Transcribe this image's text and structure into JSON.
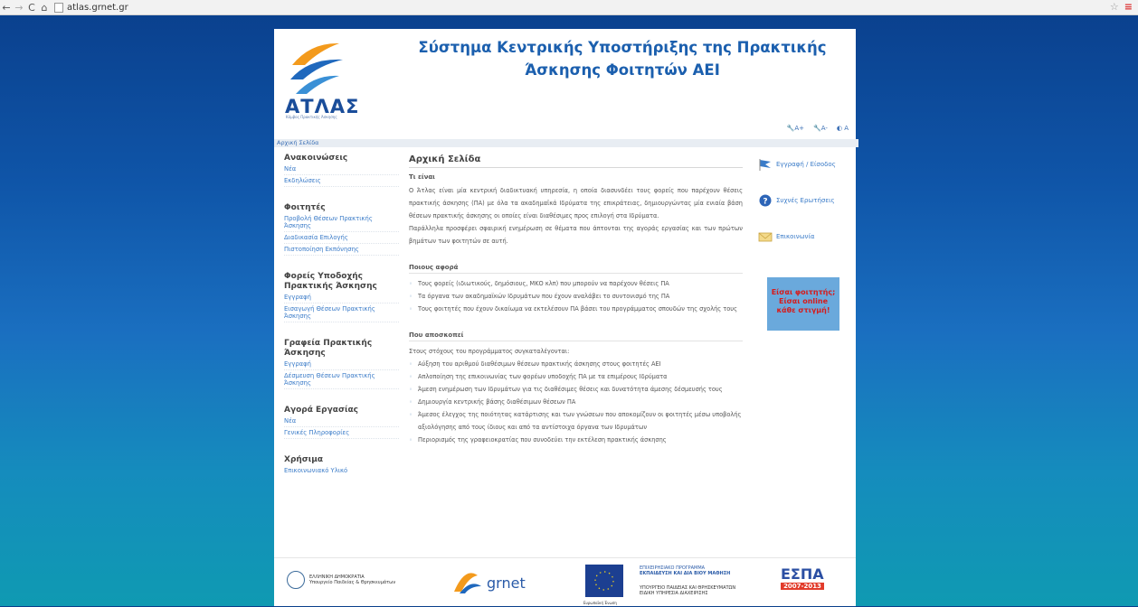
{
  "browser": {
    "url": "atlas.grnet.gr",
    "back": "←",
    "forward": "→",
    "reload": "C",
    "home": "⌂",
    "star": "☆",
    "menu": "≡"
  },
  "header": {
    "logo_text": "ΑΤΛΑΣ",
    "logo_subtitle": "Κόμβος Πρακτικής Άσκησης",
    "site_title": "Σύστημα Κεντρικής Υποστήριξης της Πρακτικής Άσκησης Φοιτητών ΑΕΙ",
    "accessibility": {
      "increase": "A+",
      "decrease": "A-",
      "contrast": "A"
    }
  },
  "breadcrumb": "Αρχική Σελίδα",
  "sidebar": {
    "sections": [
      {
        "title": "Ανακοινώσεις",
        "items": [
          "Νέα",
          "Εκδηλώσεις"
        ]
      },
      {
        "title": "Φοιτητές",
        "items": [
          "Προβολή Θέσεων Πρακτικής Άσκησης",
          "Διαδικασία Επιλογής",
          "Πιστοποίηση Εκπόνησης"
        ]
      },
      {
        "title": "Φορείς Υποδοχής Πρακτικής Άσκησης",
        "items": [
          "Εγγραφή",
          "Εισαγωγή Θέσεων Πρακτικής Άσκησης"
        ]
      },
      {
        "title": "Γραφεία Πρακτικής Άσκησης",
        "items": [
          "Εγγραφή",
          "Δέσμευση Θέσεων Πρακτικής Άσκησης"
        ]
      },
      {
        "title": "Αγορά Εργασίας",
        "items": [
          "Νέα",
          "Γενικές Πληροφορίες"
        ]
      },
      {
        "title": "Χρήσιμα",
        "items": [
          "Επικοινωνιακό Υλικό"
        ]
      }
    ]
  },
  "main": {
    "title": "Αρχική Σελίδα",
    "what_title": "Τι είναι",
    "what_p1": "Ο Άτλας είναι μία κεντρική διαδικτυακή υπηρεσία, η οποία διασυνδέει τους φορείς που παρέχουν θέσεις πρακτικής άσκησης (ΠΑ) με όλα τα ακαδημαϊκά Ιδρύματα της επικράτειας, δημιουργώντας μία ενιαία βάση θέσεων πρακτικής άσκησης οι οποίες είναι διαθέσιμες προς επιλογή στα Ιδρύματα.",
    "what_p2": "Παράλληλα προσφέρει σφαιρική ενημέρωση σε θέματα που άπτονται της αγοράς εργασίας και των πρώτων βημάτων των φοιτητών σε αυτή.",
    "who_title": "Ποιους αφορά",
    "who_items": [
      "Τους φορείς (ιδιωτικούς, δημόσιους, ΜΚΟ κλπ) που μπορούν να παρέχουν θέσεις ΠΑ",
      "Τα όργανα των ακαδημαϊκών Ιδρυμάτων που έχουν αναλάβει το συντονισμό της ΠΑ",
      "Τους φοιτητές που έχουν δικαίωμα να εκτελέσουν ΠΑ βάσει του προγράμματος σπουδών της σχολής τους"
    ],
    "goal_title": "Που αποσκοπεί",
    "goal_intro": "Στους στόχους του προγράμματος συγκαταλέγονται:",
    "goal_items": [
      "Αύξηση του αριθμού διαθέσιμων θέσεων πρακτικής άσκησης στους φοιτητές ΑΕΙ",
      "Απλοποίηση της επικοινωνίας των φορέων υποδοχής ΠΑ με τα επιμέρους Ιδρύματα",
      "Άμεση ενημέρωση των Ιδρυμάτων για τις διαθέσιμες θέσεις και δυνατότητα άμεσης δέσμευσής τους",
      "Δημιουργία κεντρικής βάσης διαθέσιμων θέσεων ΠΑ",
      "Άμεσος έλεγχος της ποιότητας κατάρτισης και των γνώσεων που αποκομίζουν οι φοιτητές μέσω υποβολής αξιολόγησης από τους ίδιους και από τα αντίστοιχα όργανα των Ιδρυμάτων",
      "Περιορισμός της γραφειοκρατίας που συνοδεύει την εκτέλεση πρακτικής άσκησης"
    ]
  },
  "right": {
    "login": "Εγγραφή / Είσοδος",
    "faq": "Συχνές Ερωτήσεις",
    "contact": "Επικοινωνία",
    "promo_line1": "Είσαι φοιτητής;",
    "promo_line2": "Είσαι online",
    "promo_line3": "κάθε στιγμή!"
  },
  "footer": {
    "greek_state": "ΕΛΛΗΝΙΚΗ ΔΗΜΟΚΡΑΤΙΑ",
    "ministry": "Υπουργείο Παιδείας & Θρησκευμάτων",
    "grnet": "grnet",
    "eu": "Ευρωπαϊκή Ένωση",
    "program_line1": "ΕΠΙΧΕΙΡΗΣΙΑΚΟ ΠΡΟΓΡΑΜΜΑ",
    "program_line2": "ΕΚΠΑΙΔΕΥΣΗ ΚΑΙ ΔΙΑ ΒΙΟΥ ΜΑΘΗΣΗ",
    "program_line3": "ΥΠΟΥΡΓΕΙΟ ΠΑΙΔΕΙΑΣ ΚΑΙ ΘΡΗΣΚΕΥΜΑΤΩΝ",
    "program_line4": "ΕΙΔΙΚΗ ΥΠΗΡΕΣΙΑ ΔΙΑΧΕΙΡΙΣΗΣ",
    "espa": "ΕΣΠΑ",
    "espa_years": "2007-2013"
  },
  "colors": {
    "title_blue": "#1b5fae",
    "link_blue": "#3a7bc8",
    "promo_bg": "#6aa9dc",
    "promo_text": "#d61b1b"
  }
}
